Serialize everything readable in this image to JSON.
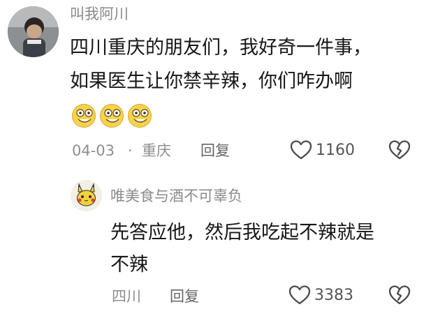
{
  "comment": {
    "username": "叫我阿川",
    "text_line1": "四川重庆的朋友们，我好奇一件事，",
    "text_line2": "如果医生让你禁辛辣，你们咋办啊",
    "date": "04-03",
    "separator": "·",
    "location": "重庆",
    "reply_label": "回复",
    "like_count": "1160",
    "emojis": [
      "grin-emoji",
      "grin-emoji",
      "grin-emoji"
    ]
  },
  "reply": {
    "username": "唯美食与酒不可辜负",
    "text_line1": "先答应他，然后我吃起不辣就是",
    "text_line2": "不辣",
    "location": "四川",
    "reply_label": "回复",
    "like_count": "3383"
  },
  "icons": {
    "like": "heart-icon",
    "dislike": "broken-heart-icon"
  },
  "colors": {
    "text": "#161616",
    "meta": "#8e8e8e",
    "emoji": "#f6d34a"
  }
}
